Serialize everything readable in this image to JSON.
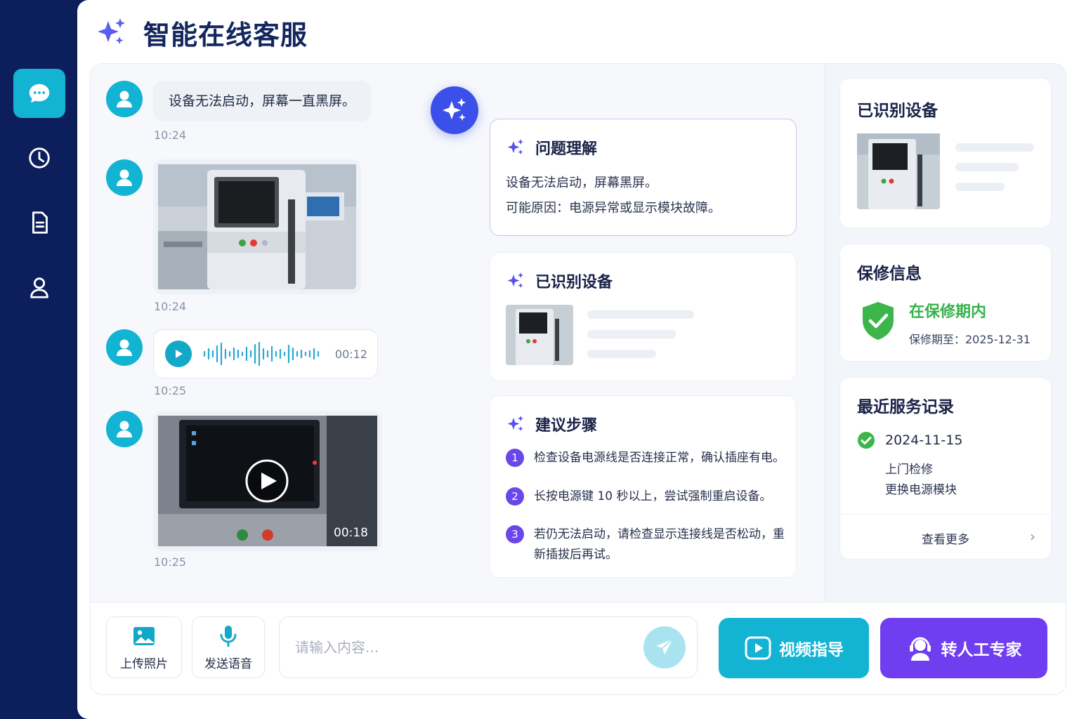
{
  "app": {
    "title": "智能在线客服"
  },
  "chat": {
    "messages": [
      {
        "type": "text",
        "text": "设备无法启动，屏幕一直黑屏。",
        "time": "10:24"
      },
      {
        "type": "image",
        "time": "10:24"
      },
      {
        "type": "voice",
        "duration": "00:12",
        "time": "10:25"
      },
      {
        "type": "video",
        "duration": "00:18",
        "time": "10:25"
      }
    ]
  },
  "ai": {
    "problem": {
      "title": "问题理解",
      "line1": "设备无法启动，屏幕黑屏。",
      "line2": "可能原因：电源异常或显示模块故障。"
    },
    "device": {
      "title": "已识别设备"
    },
    "steps": {
      "title": "建议步骤",
      "items": [
        {
          "num": "1",
          "text": "检查设备电源线是否连接正常，确认插座有电。"
        },
        {
          "num": "2",
          "text": "长按电源键 10 秒以上，尝试强制重启设备。"
        },
        {
          "num": "3",
          "text": "若仍无法启动，请检查显示连接线是否松动，重新插拔后再试。"
        }
      ]
    }
  },
  "panel": {
    "device": {
      "title": "已识别设备"
    },
    "warranty": {
      "title": "保修信息",
      "status": "在保修期内",
      "until": "保修期至：2025-12-31"
    },
    "records": {
      "title": "最近服务记录",
      "date": "2024-11-15",
      "type": "上门检修",
      "detail": "更换电源模块",
      "more": "查看更多"
    }
  },
  "bottom": {
    "upload_photo": "上传照片",
    "send_voice": "发送语音",
    "input_placeholder": "请输入内容...",
    "video_guide": "视频指导",
    "transfer_expert": "转人工专家"
  },
  "colors": {
    "sidebar": "#0c1e5c",
    "accent_cyan": "#12b3d3",
    "accent_purple": "#6f3ef0",
    "success": "#35b24a"
  }
}
